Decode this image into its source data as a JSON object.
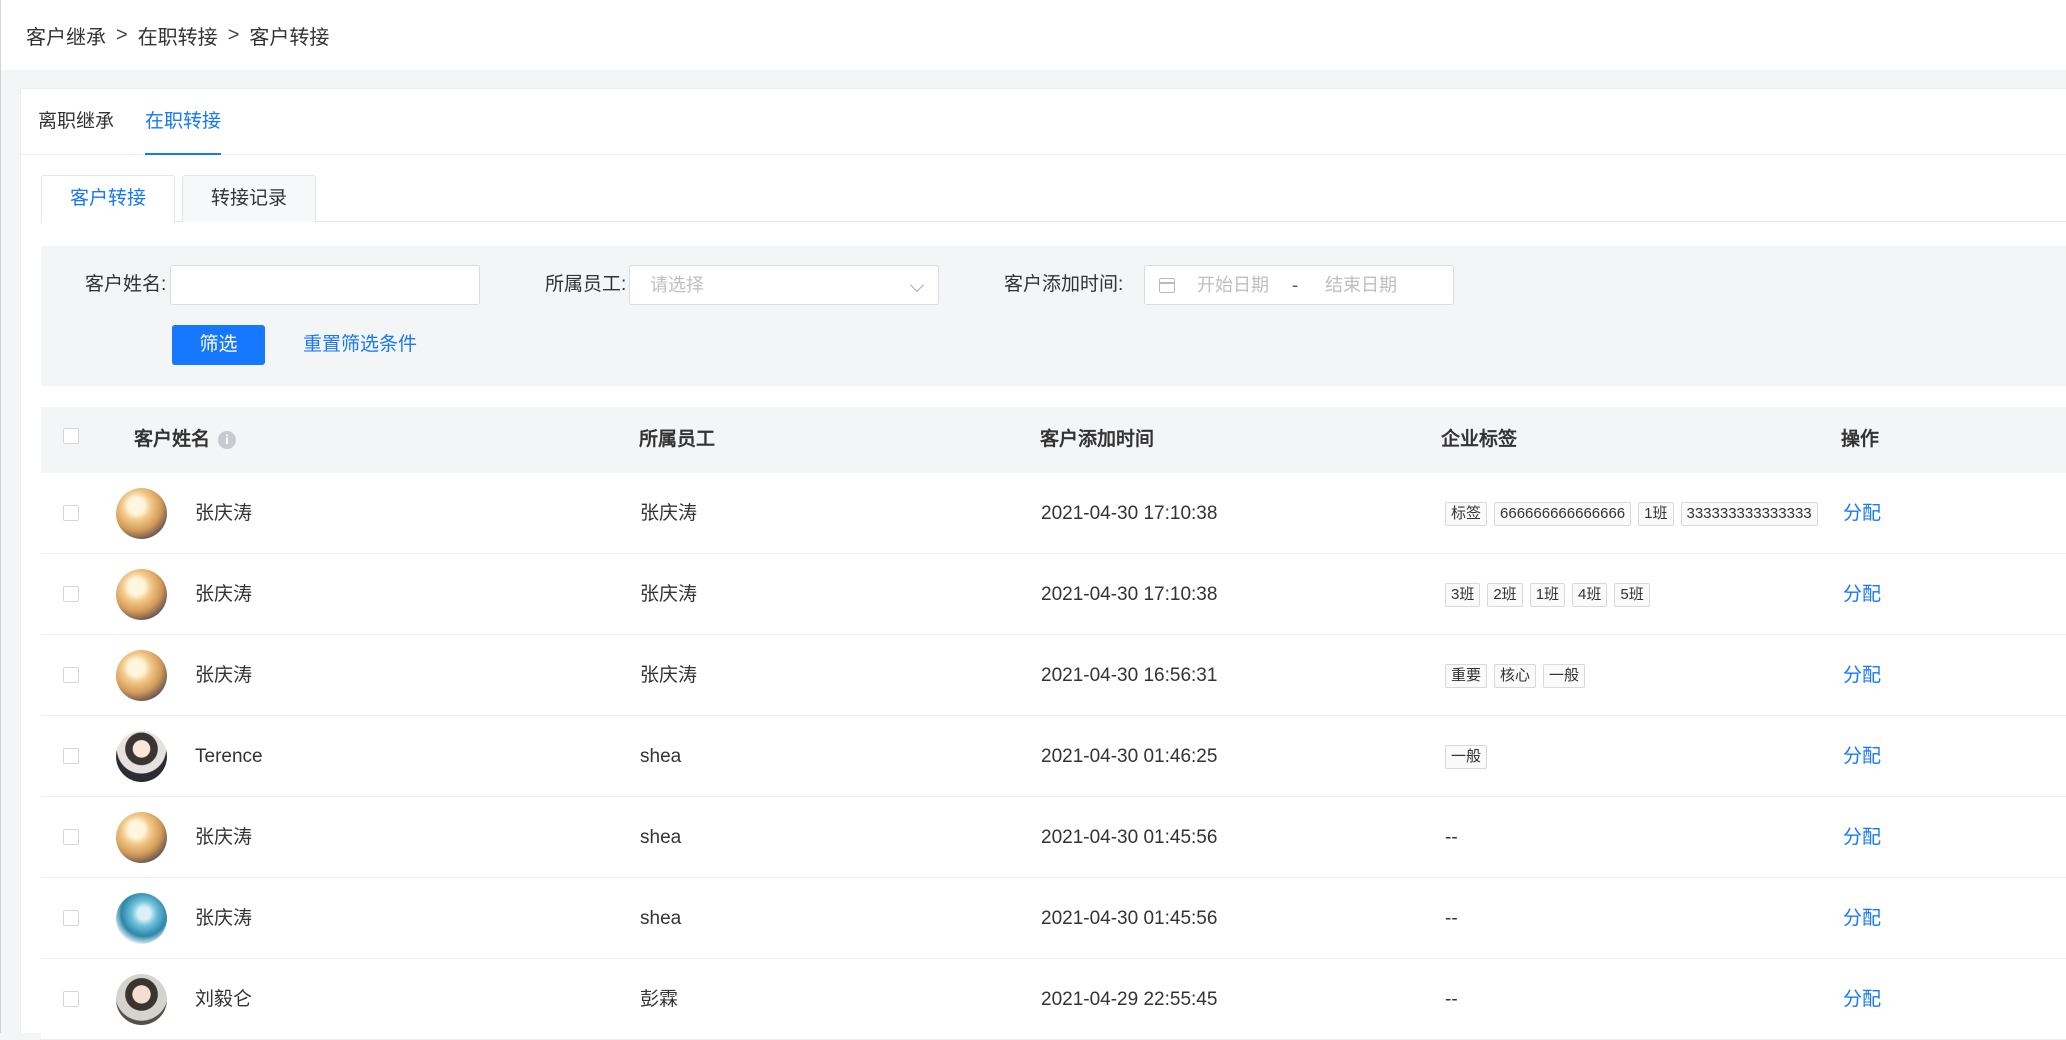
{
  "breadcrumb": {
    "items": [
      "客户继承",
      "在职转接",
      "客户转接"
    ],
    "separator": ">"
  },
  "top_tabs": [
    {
      "label": "离职继承",
      "active": false
    },
    {
      "label": "在职转接",
      "active": true
    }
  ],
  "sub_tabs": [
    {
      "label": "客户转接",
      "active": true
    },
    {
      "label": "转接记录",
      "active": false
    }
  ],
  "filter": {
    "customer_name_label": "客户姓名:",
    "customer_name_value": "",
    "employee_label": "所属员工:",
    "employee_placeholder": "请选择",
    "add_time_label": "客户添加时间:",
    "start_date_placeholder": "开始日期",
    "range_separator": "-",
    "end_date_placeholder": "结束日期",
    "filter_button": "筛选",
    "reset_button": "重置筛选条件"
  },
  "table": {
    "columns": [
      "客户姓名",
      "所属员工",
      "客户添加时间",
      "企业标签",
      "操作"
    ],
    "info_icon": "info-icon",
    "rows": [
      {
        "name": "张庆涛",
        "avatar": "a",
        "employee": "张庆涛",
        "time": "2021-04-30 17:10:38",
        "tags": [
          "标签",
          "666666666666666",
          "1班",
          "333333333333333"
        ],
        "action": "分配"
      },
      {
        "name": "张庆涛",
        "avatar": "a",
        "employee": "张庆涛",
        "time": "2021-04-30 17:10:38",
        "tags": [
          "3班",
          "2班",
          "1班",
          "4班",
          "5班"
        ],
        "action": "分配"
      },
      {
        "name": "张庆涛",
        "avatar": "a",
        "employee": "张庆涛",
        "time": "2021-04-30 16:56:31",
        "tags": [
          "重要",
          "核心",
          "一般"
        ],
        "action": "分配"
      },
      {
        "name": "Terence",
        "avatar": "b",
        "employee": "shea",
        "time": "2021-04-30 01:46:25",
        "tags": [
          "一般"
        ],
        "action": "分配"
      },
      {
        "name": "张庆涛",
        "avatar": "a",
        "employee": "shea",
        "time": "2021-04-30 01:45:56",
        "tags": [],
        "empty_tags": "--",
        "action": "分配"
      },
      {
        "name": "张庆涛",
        "avatar": "c",
        "employee": "shea",
        "time": "2021-04-30 01:45:56",
        "tags": [],
        "empty_tags": "--",
        "action": "分配"
      },
      {
        "name": "刘毅仑",
        "avatar": "d",
        "employee": "彭霖",
        "time": "2021-04-29 22:55:45",
        "tags": [],
        "empty_tags": "--",
        "action": "分配"
      }
    ]
  },
  "colors": {
    "accent": "#1677ff",
    "background": "#f4f5f7"
  }
}
